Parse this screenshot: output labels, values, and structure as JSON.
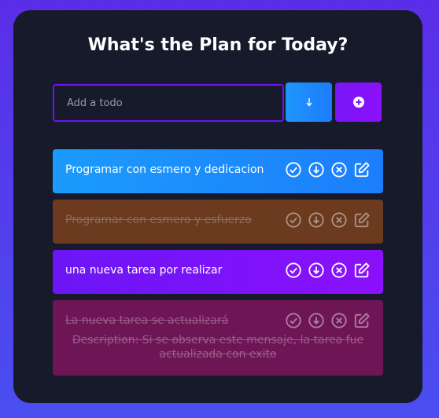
{
  "app": {
    "title": "What's the Plan for Today?"
  },
  "form": {
    "placeholder": "Add a todo",
    "value": "",
    "sort_icon": "arrow-down-icon",
    "add_icon": "plus-circle-icon"
  },
  "todos": [
    {
      "text": "Programar con esmero y dedicacion",
      "completed": false,
      "color": "#1b9bfc"
    },
    {
      "text": "Programar con esmero y esfuerzo",
      "completed": true,
      "color": "#6b3a1f"
    },
    {
      "text": "una nueva tarea por realizar",
      "completed": false,
      "color": "#6b16f6"
    },
    {
      "text": "La nueva tarea se actualizará",
      "completed": true,
      "color": "#6e1556",
      "description": "Description: Si se observa este mensaje, la tarea fue actualizada con exito"
    }
  ],
  "actions": [
    "check-circle-icon",
    "download-circle-icon",
    "close-circle-icon",
    "edit-icon"
  ]
}
